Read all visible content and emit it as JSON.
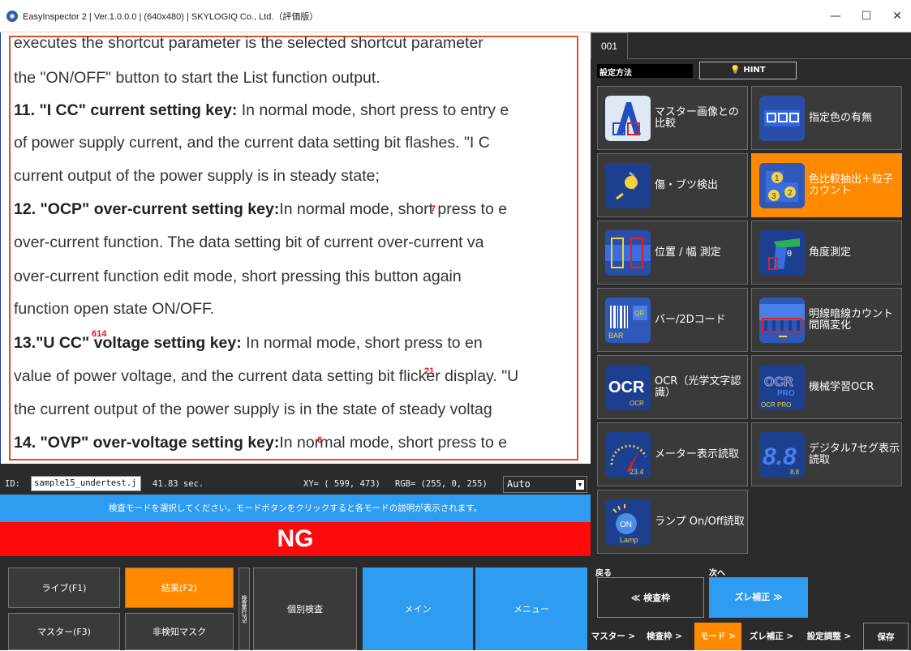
{
  "window": {
    "title": "EasyInspector 2 | Ver.1.0.0.0 | (640x480) | SKYLOGIQ Co., Ltd.（評価版）",
    "minimize": "—",
    "maximize": "☐",
    "close": "✕"
  },
  "document": {
    "lines": [
      {
        "bold": "",
        "text": "executes the shortcut parameter is the selected shortcut parameter"
      },
      {
        "bold": "",
        "text": "the \"ON/OFF\" button to start the List function output."
      },
      {
        "bold": "11. \"I CC\" current setting key:",
        "text": " In normal mode, short press to entry e"
      },
      {
        "bold": "",
        "text": "of power supply current, and the current data setting bit flashes. \"I C"
      },
      {
        "bold": "",
        "text": "current output of the power supply is in steady state;"
      },
      {
        "bold": "12. \"OCP\" over-current setting key:",
        "text": "In normal mode, short press to e"
      },
      {
        "bold": "",
        "text": "over-current function. The data setting bit of current over-current va"
      },
      {
        "bold": "",
        "text": "over-current function edit mode, short pressing this button again"
      },
      {
        "bold": "",
        "text": "function open state ON/OFF."
      },
      {
        "bold": "13.\"U CC\" voltage setting key:",
        "text": " In normal mode, short press to en"
      },
      {
        "bold": "",
        "text": "value of power voltage, and the current data setting bit flicker display. \"U"
      },
      {
        "bold": "",
        "text": "the current output of the power supply is in the state of steady voltag"
      },
      {
        "bold": "14. \"OVP\" over-voltage setting key:",
        "text": "In normal mode, short press to e"
      }
    ],
    "marks": [
      "7",
      "614",
      "21",
      "6"
    ]
  },
  "infobar": {
    "id_label": "ID:",
    "id_value": "sample15_undertest.j",
    "seconds": "41.83 sec.",
    "xy": "XY= ( 599,  473)",
    "rgb": "RGB= (255,   0, 255)",
    "mode_select": "Auto"
  },
  "guide_text": "検査モードを選択してください。モードボタンをクリックすると各モードの説明が表示されます。",
  "result": "NG",
  "bottom": {
    "live": "ライブ(F1)",
    "result": "結果(F2)",
    "master": "マスター(F3)",
    "nondetect": "非検知マスク",
    "vertical": "検査実行(F5)",
    "individual": "個別検査",
    "main": "メイン",
    "menu": "メニュー"
  },
  "panel": {
    "tab": "001",
    "method_label": "設定方法",
    "hint": "HINT",
    "modes": [
      {
        "label": "マスター画像との比較",
        "icon": "master-compare-icon"
      },
      {
        "label": "指定色の有無",
        "icon": "color-presence-icon"
      },
      {
        "label": "傷・ブツ検出",
        "icon": "scratch-detect-icon"
      },
      {
        "label": "色比較抽出＋粒子カウント",
        "icon": "particle-count-icon"
      },
      {
        "label": "位置 / 幅 測定",
        "icon": "position-width-icon"
      },
      {
        "label": "角度測定",
        "icon": "angle-measure-icon"
      },
      {
        "label": "バー/2Dコード",
        "icon": "barcode-icon"
      },
      {
        "label": "明線暗線カウント間隔変化",
        "icon": "line-count-icon"
      },
      {
        "label": "OCR（光学文字認識）",
        "icon": "ocr-icon"
      },
      {
        "label": "機械学習OCR",
        "icon": "ml-ocr-icon"
      },
      {
        "label": "メーター表示読取",
        "icon": "meter-icon"
      },
      {
        "label": "デジタル7セグ表示読取",
        "icon": "seven-seg-icon"
      },
      {
        "label": "ランプ On/Off読取",
        "icon": "lamp-icon"
      }
    ],
    "icon_text": {
      "bar": "BAR",
      "qr": "QR",
      "ocr": "OCR",
      "ocr_small": "OCR",
      "ocr_pro": "OCR PRO",
      "pro": "PRO",
      "meter_value": "23.4",
      "seg": "8.8",
      "seg_small": "8.8",
      "lamp_on": "ON",
      "lamp": "Lamp",
      "theta": "θ"
    },
    "back_label": "戻る",
    "next_label": "次へ",
    "back_button": "≪ 検査枠",
    "next_button": "ズレ補正 ≫",
    "crumbs": [
      "マスター >",
      "検査枠 >",
      "モード >",
      "ズレ補正 >",
      "設定調整 >",
      "保存"
    ]
  },
  "colors": {
    "orange": "#ff8a00",
    "blue": "#2e9cf0",
    "ng_red": "#ff0a0a",
    "panel_bg": "#2b2b2b"
  }
}
